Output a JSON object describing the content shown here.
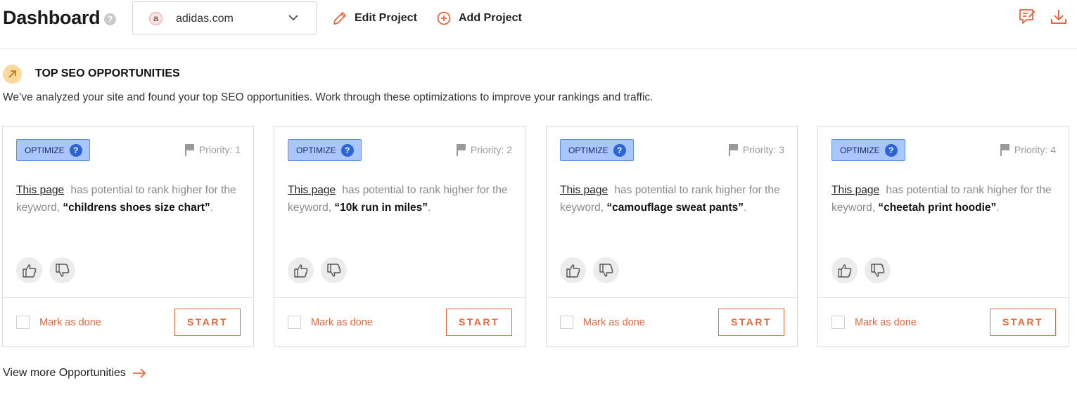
{
  "header": {
    "title": "Dashboard",
    "help": "?",
    "project": {
      "avatar_letter": "a",
      "name": "adidas.com"
    },
    "edit_label": "Edit Project",
    "add_label": "Add Project"
  },
  "section": {
    "title": "TOP SEO OPPORTUNITIES",
    "description": "We’ve analyzed your site and found your top SEO opportunities. Work through these optimizations to improve your rankings and traffic."
  },
  "cards": [
    {
      "badge": "OPTIMIZE",
      "priority": "Priority: 1",
      "link": "This page",
      "text": "has potential to rank higher for the keyword,",
      "keyword": "“childrens shoes size chart”",
      "end": ".",
      "mark_label": "Mark as done",
      "start_label": "START"
    },
    {
      "badge": "OPTIMIZE",
      "priority": "Priority: 2",
      "link": "This page",
      "text": "has potential to rank higher for the keyword,",
      "keyword": "“10k run in miles”",
      "end": ".",
      "mark_label": "Mark as done",
      "start_label": "START"
    },
    {
      "badge": "OPTIMIZE",
      "priority": "Priority: 3",
      "link": "This page",
      "text": "has potential to rank higher for the keyword,",
      "keyword": "“camouflage sweat pants”",
      "end": ".",
      "mark_label": "Mark as done",
      "start_label": "START"
    },
    {
      "badge": "OPTIMIZE",
      "priority": "Priority: 4",
      "link": "This page",
      "text": "has potential to rank higher for the keyword,",
      "keyword": "“cheetah print hoodie”",
      "end": ".",
      "mark_label": "Mark as done",
      "start_label": "START"
    }
  ],
  "badge_help": "?",
  "view_more": "View more Opportunities",
  "colors": {
    "accent": "#e8663d",
    "badge_bg": "#a9c6ff",
    "badge_border": "#5b8ee6",
    "section_icon_bg": "#fbd9a1"
  }
}
